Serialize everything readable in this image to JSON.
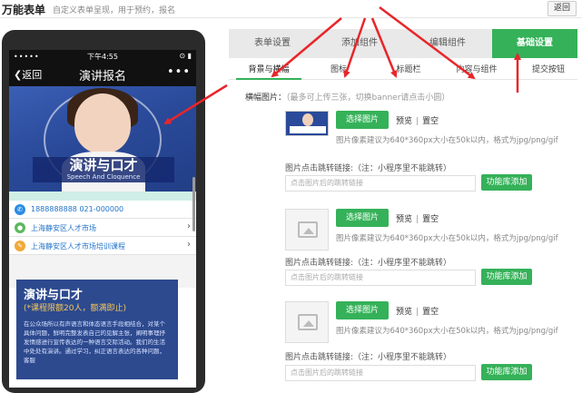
{
  "header": {
    "title": "万能表单",
    "subtitle": "自定义表单呈现，用于预约，报名",
    "back_label": "返回"
  },
  "phone": {
    "status_dots": "•••••",
    "time": "下午4:55",
    "status_icons": "⊙ ▮",
    "back_label": "❮返回",
    "title": "演讲报名",
    "more": "•••",
    "banner_title": "演讲与口才",
    "banner_en": "Speech And Cloquence",
    "rows": [
      {
        "text": "1888888888    021-000000",
        "icon": "phone-icon",
        "color": "#2b8de3"
      },
      {
        "text": "上海静安区人才市场",
        "icon": "location-icon",
        "color": "#5cb85c"
      },
      {
        "text": "上海静安区人才市场培训课程",
        "icon": "pencil-icon",
        "color": "#f0a93b"
      }
    ],
    "poster_title": "演讲与口才",
    "poster_sub": "(*课程限额20人，额满即止)",
    "poster_body": "在公众场所以有声语言和体态语言手段相结合，对某个具体问题，鲜明完整发表自己的见解主张，阐明事理抒发情感进行宣传表达的一种语言交际活动。我们的生活中处处有演讲。通过学习，纠正语言表达的各种问题，客服"
  },
  "tabs_main": [
    {
      "label": "表单设置",
      "active": false
    },
    {
      "label": "添加组件",
      "active": false
    },
    {
      "label": "编辑组件",
      "active": false
    },
    {
      "label": "基础设置",
      "active": true
    }
  ],
  "tabs_sub": [
    {
      "label": "背景与横幅",
      "active": true
    },
    {
      "label": "图标",
      "active": false
    },
    {
      "label": "标题栏",
      "active": false
    },
    {
      "label": "内容与组件",
      "active": false
    },
    {
      "label": "提交按钮",
      "active": false
    }
  ],
  "banner_section": {
    "label": "横幅图片：",
    "hint": "（最多可上传三张，切换banner请点击小圆）",
    "items": [
      {
        "has_image": true
      },
      {
        "has_image": false
      },
      {
        "has_image": false
      }
    ],
    "choose_label": "选择图片",
    "preview_label": "预览",
    "clear_label": "置空",
    "size_hint": "图片像素建议为640*360px大小在50k以内，格式为jpg/png/gif",
    "link_label": "图片点击跳转链接:（注：小程序里不能跳转）",
    "link_placeholder": "点击图片后的跳转链接",
    "lib_label": "功能库添加"
  },
  "colors": {
    "accent": "#35b159",
    "phone_frame": "#2b2b2b",
    "banner_blue": "#2a4a9a",
    "arrow_red": "#e8262b"
  }
}
